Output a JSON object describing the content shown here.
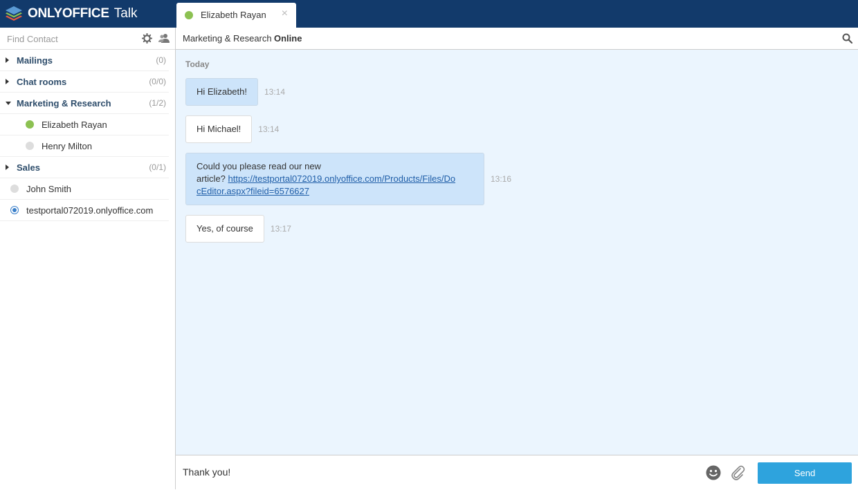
{
  "app": {
    "brand": "ONLYOFFICE",
    "product": "Talk"
  },
  "tab": {
    "label": "Elizabeth Rayan",
    "close": "×"
  },
  "sidebar": {
    "search_placeholder": "Find Contact",
    "groups": [
      {
        "label": "Mailings",
        "count": "(0)",
        "expanded": false
      },
      {
        "label": "Chat rooms",
        "count": "(0/0)",
        "expanded": false
      },
      {
        "label": "Marketing & Research",
        "count": "(1/2)",
        "expanded": true,
        "contacts": [
          {
            "label": "Elizabeth Rayan",
            "status": "online"
          },
          {
            "label": "Henry Milton",
            "status": "offline"
          }
        ]
      },
      {
        "label": "Sales",
        "count": "(0/1)",
        "expanded": false
      }
    ],
    "loose_contacts": [
      {
        "label": "John Smith",
        "status": "offline"
      },
      {
        "label": "testportal072019.onlyoffice.com",
        "status": "self"
      }
    ]
  },
  "chat_header": {
    "group": "Marketing & Research",
    "status": "Online"
  },
  "messages": {
    "day": "Today",
    "items": [
      {
        "direction": "out",
        "text": "Hi Elizabeth!",
        "time": "13:14"
      },
      {
        "direction": "in",
        "text": "Hi Michael!",
        "time": "13:14"
      },
      {
        "direction": "out",
        "text_line1": "Could you please read our new",
        "text_line2_prefix": "article? ",
        "link_part1": "https://testportal072019.onlyoffice.com/Products/Files/Do",
        "link_part2": "cEditor.aspx?fileid=6576627",
        "time": "13:16"
      },
      {
        "direction": "in",
        "text": "Yes, of course",
        "time": "13:17"
      }
    ]
  },
  "composer": {
    "value": "Thank you!",
    "send_label": "Send"
  },
  "colors": {
    "topbar": "#123a6b",
    "online": "#8cc152",
    "send": "#2ea3dd",
    "chat_bg": "#ebf5fe"
  }
}
